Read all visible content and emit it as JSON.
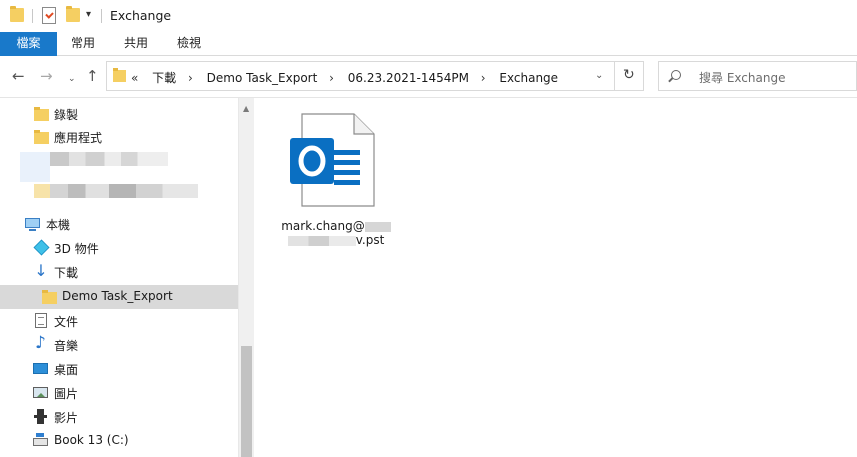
{
  "window": {
    "title": "Exchange"
  },
  "ribbon": {
    "file_tab": "檔案",
    "tabs": [
      "常用",
      "共用",
      "檢視"
    ]
  },
  "address": {
    "overflow": "«",
    "crumbs": [
      "下載",
      "Demo Task_Export",
      "06.23.2021-1454PM",
      "Exchange"
    ],
    "separator": "›"
  },
  "search": {
    "placeholder": "搜尋 Exchange"
  },
  "nav": {
    "items": [
      {
        "label": "錄製",
        "icon": "folder-icon"
      },
      {
        "label": "應用程式",
        "icon": "folder-icon"
      },
      {
        "label": "本機",
        "icon": "computer-icon"
      },
      {
        "label": "3D 物件",
        "icon": "3d-objects-icon"
      },
      {
        "label": "下載",
        "icon": "downloads-icon"
      },
      {
        "label": "Demo Task_Export",
        "icon": "folder-icon",
        "selected": true
      },
      {
        "label": "文件",
        "icon": "documents-icon"
      },
      {
        "label": "音樂",
        "icon": "music-icon"
      },
      {
        "label": "桌面",
        "icon": "desktop-icon"
      },
      {
        "label": "圖片",
        "icon": "pictures-icon"
      },
      {
        "label": "影片",
        "icon": "videos-icon"
      },
      {
        "label": "Book 13 (C:)",
        "icon": "drive-icon"
      }
    ]
  },
  "files": [
    {
      "name_line1": "mark.chang@",
      "name_line2_suffix": "v.pst",
      "icon": "outlook-pst-icon"
    }
  ],
  "colors": {
    "accent": "#1979ca",
    "outlook_blue": "#0a6fc2",
    "selected_row": "#d9d9d9",
    "folder": "#f5cf62"
  }
}
